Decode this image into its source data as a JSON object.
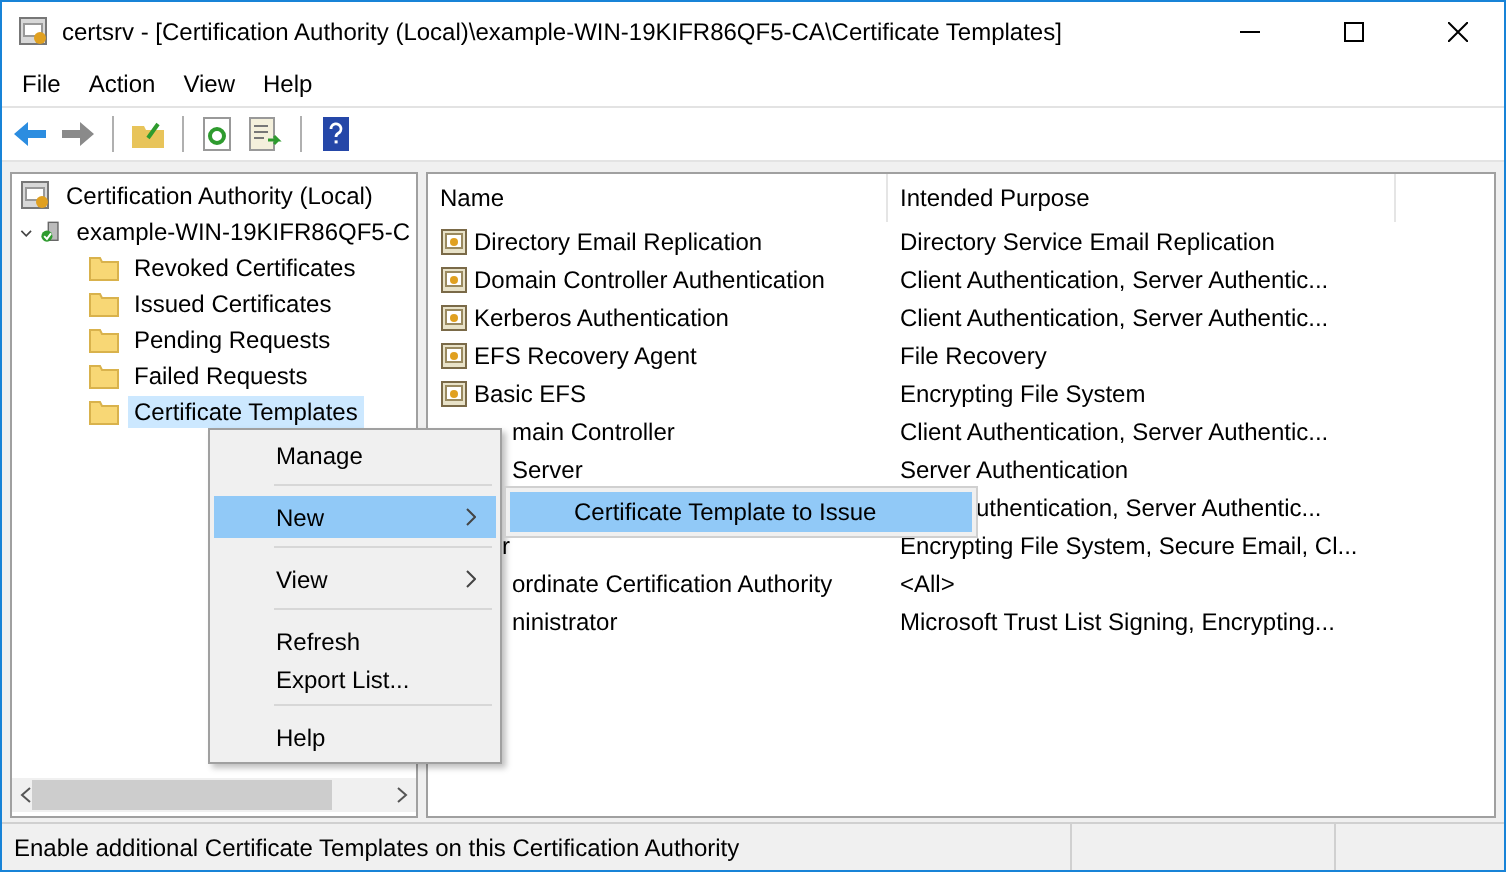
{
  "window": {
    "title": "certsrv - [Certification Authority (Local)\\example-WIN-19KIFR86QF5-CA\\Certificate Templates]"
  },
  "menu_bar": [
    "File",
    "Action",
    "View",
    "Help"
  ],
  "toolbar": [
    {
      "kind": "back",
      "disabled": false
    },
    {
      "kind": "forward",
      "disabled": true
    },
    {
      "kind": "up",
      "disabled": false
    },
    {
      "kind": "refresh",
      "disabled": false
    },
    {
      "kind": "export",
      "disabled": false
    },
    {
      "kind": "help",
      "disabled": false
    }
  ],
  "tree": [
    {
      "label": "Certification Authority (Local)",
      "kind": "root",
      "selected": false,
      "children": [
        {
          "label": "example-WIN-19KIFR86QF5-C",
          "kind": "server",
          "expanded": true,
          "selected": false,
          "children": [
            {
              "label": "Revoked Certificates",
              "kind": "folder",
              "selected": false
            },
            {
              "label": "Issued Certificates",
              "kind": "folder",
              "selected": false
            },
            {
              "label": "Pending Requests",
              "kind": "folder",
              "selected": false
            },
            {
              "label": "Failed Requests",
              "kind": "folder",
              "selected": false
            },
            {
              "label": "Certificate Templates",
              "kind": "folder",
              "selected": true
            }
          ]
        }
      ]
    }
  ],
  "table": {
    "columns": [
      "Name",
      "Intended Purpose"
    ],
    "rows": [
      {
        "name": "Directory Email Replication",
        "icon": true,
        "purpose": "Directory Service Email Replication"
      },
      {
        "name": "Domain Controller Authentication",
        "icon": true,
        "purpose": "Client Authentication, Server Authentic..."
      },
      {
        "name": "Kerberos Authentication",
        "icon": true,
        "purpose": "Client Authentication, Server Authentic..."
      },
      {
        "name": "EFS Recovery Agent",
        "icon": true,
        "purpose": "File Recovery"
      },
      {
        "name": "Basic EFS",
        "icon": true,
        "purpose": "Encrypting File System"
      },
      {
        "name": "main Controller",
        "icon": false,
        "purpose": "Client Authentication, Server Authentic..."
      },
      {
        "name": "Server",
        "icon": false,
        "purpose": "Server Authentication"
      },
      {
        "icon": false,
        "purpose": "uthentication, Server Authentic..."
      },
      {
        "name": "r",
        "icon": false,
        "purpose": "Encrypting File System, Secure Email, Cl..."
      },
      {
        "name": "ordinate Certification Authority",
        "icon": false,
        "purpose": "<All>"
      },
      {
        "name": "ninistrator",
        "icon": false,
        "purpose": "Microsoft Trust List Signing, Encrypting..."
      }
    ]
  },
  "context_menu": {
    "items": [
      {
        "label": "Manage",
        "submenu": false,
        "selected": false
      },
      {
        "label": "New",
        "submenu": true,
        "selected": true,
        "separator_before": true
      },
      {
        "label": "View",
        "submenu": true,
        "selected": false,
        "separator_before": true
      },
      {
        "label": "Refresh",
        "submenu": false,
        "selected": false,
        "separator_before": true
      },
      {
        "label": "Export List...",
        "submenu": false,
        "selected": false
      },
      {
        "label": "Help",
        "submenu": false,
        "selected": false,
        "separator_before": true
      }
    ],
    "submenu": {
      "items": [
        {
          "label": "Certificate Template to Issue",
          "selected": true
        }
      ]
    }
  },
  "status_bar": {
    "text": "Enable additional Certificate Templates on this Certification Authority"
  }
}
